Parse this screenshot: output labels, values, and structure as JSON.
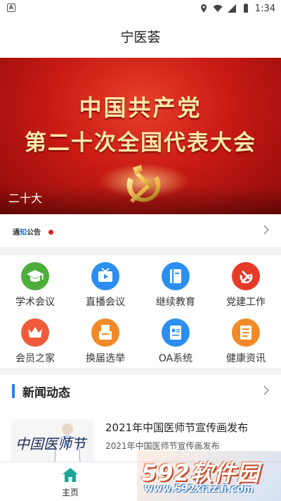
{
  "status_bar": {
    "time": "1:34",
    "left_icon": "A"
  },
  "app_bar": {
    "title": "宁医荟"
  },
  "banner": {
    "headline_line1": "中国共产党",
    "headline_line2": "第二十次全国代表大会",
    "caption": "二十大"
  },
  "notice": {
    "tag_prefix": "通",
    "tag_highlight": "知",
    "tag_suffix": "公告",
    "has_unread": true
  },
  "grid": {
    "items": [
      {
        "label": "学术会议",
        "icon": "graduation-cap-icon",
        "color": "#4caf3c"
      },
      {
        "label": "直播会议",
        "icon": "tv-play-icon",
        "color": "#2a8ff0"
      },
      {
        "label": "继续教育",
        "icon": "book-icon",
        "color": "#2a8ff0"
      },
      {
        "label": "党建工作",
        "icon": "party-emblem-icon",
        "color": "#e53a28"
      },
      {
        "label": "会员之家",
        "icon": "crown-icon",
        "color": "#ef5a3a"
      },
      {
        "label": "换届选举",
        "icon": "ballot-box-icon",
        "color": "#f08a28"
      },
      {
        "label": "OA系统",
        "icon": "id-card-icon",
        "color": "#2a8ff0"
      },
      {
        "label": "健康资讯",
        "icon": "document-icon",
        "color": "#f08a28"
      }
    ]
  },
  "news": {
    "section_title": "新闻动态",
    "items": [
      {
        "title": "2021年中国医师节宣传画发布",
        "subtitle": "2021年中国医师节宣传画发布",
        "thumb_text": "中国医师节"
      }
    ]
  },
  "bottom_nav": {
    "home_label": "主页"
  },
  "watermark": {
    "brand": "592软件园",
    "url": "www.592xiazai.com"
  },
  "colors": {
    "accent": "#2a7ff0",
    "banner_red": "#c91a14",
    "home_icon": "#17a79a"
  }
}
